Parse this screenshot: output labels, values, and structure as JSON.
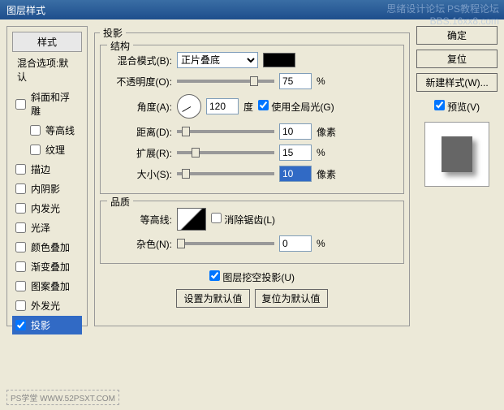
{
  "title": "图层样式",
  "watermark_top1": "思绪设计论坛",
  "watermark_top2": "BBS.16xx8.com",
  "watermark_top3": "PS教程论坛",
  "footer_mark": "PS学堂  WWW.52PSXT.COM",
  "sidebar": {
    "header": "样式",
    "sub": "混合选项:默认",
    "items": [
      {
        "label": "斜面和浮雕",
        "checked": false,
        "indent": false,
        "selected": false
      },
      {
        "label": "等高线",
        "checked": false,
        "indent": true,
        "selected": false
      },
      {
        "label": "纹理",
        "checked": false,
        "indent": true,
        "selected": false
      },
      {
        "label": "描边",
        "checked": false,
        "indent": false,
        "selected": false
      },
      {
        "label": "内阴影",
        "checked": false,
        "indent": false,
        "selected": false
      },
      {
        "label": "内发光",
        "checked": false,
        "indent": false,
        "selected": false
      },
      {
        "label": "光泽",
        "checked": false,
        "indent": false,
        "selected": false
      },
      {
        "label": "颜色叠加",
        "checked": false,
        "indent": false,
        "selected": false
      },
      {
        "label": "渐变叠加",
        "checked": false,
        "indent": false,
        "selected": false
      },
      {
        "label": "图案叠加",
        "checked": false,
        "indent": false,
        "selected": false
      },
      {
        "label": "外发光",
        "checked": false,
        "indent": false,
        "selected": false
      },
      {
        "label": "投影",
        "checked": true,
        "indent": false,
        "selected": true
      }
    ]
  },
  "main": {
    "title": "投影",
    "structure_title": "结构",
    "blend_mode_label": "混合模式(B):",
    "blend_mode_value": "正片叠底",
    "opacity_label": "不透明度(O):",
    "opacity_value": "75",
    "opacity_unit": "%",
    "angle_label": "角度(A):",
    "angle_value": "120",
    "angle_unit": "度",
    "global_light_label": "使用全局光(G)",
    "global_light_checked": true,
    "distance_label": "距离(D):",
    "distance_value": "10",
    "distance_unit": "像素",
    "spread_label": "扩展(R):",
    "spread_value": "15",
    "spread_unit": "%",
    "size_label": "大小(S):",
    "size_value": "10",
    "size_unit": "像素",
    "quality_title": "品质",
    "contour_label": "等高线:",
    "antialias_label": "消除锯齿(L)",
    "antialias_checked": false,
    "noise_label": "杂色(N):",
    "noise_value": "0",
    "noise_unit": "%",
    "knockout_label": "图层挖空投影(U)",
    "knockout_checked": true,
    "set_default": "设置为默认值",
    "reset_default": "复位为默认值"
  },
  "right": {
    "ok": "确定",
    "cancel": "复位",
    "new_style": "新建样式(W)...",
    "preview_label": "预览(V)",
    "preview_checked": true
  }
}
